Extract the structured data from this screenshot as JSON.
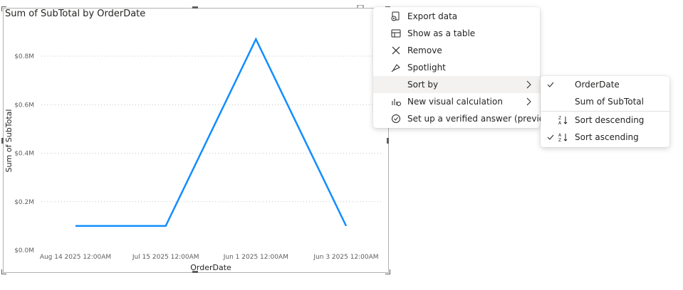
{
  "chart_data": {
    "type": "line",
    "title": "Sum of SubTotal by OrderDate",
    "xlabel": "OrderDate",
    "ylabel": "Sum of SubTotal",
    "categories": [
      "Aug 14 2025 12:00AM",
      "Jul 15 2025 12:00AM",
      "Jun 1 2025 12:00AM",
      "Jun 3 2025 12:00AM"
    ],
    "series": [
      {
        "values": [
          0.1,
          0.1,
          0.87,
          0.1
        ]
      }
    ],
    "ylim": [
      0,
      0.8
    ],
    "yticks": [
      "$0.0M",
      "$0.2M",
      "$0.4M",
      "$0.6M",
      "$0.8M"
    ],
    "ytick_values": [
      0,
      0.2,
      0.4,
      0.6,
      0.8
    ],
    "grid": true,
    "line_color": "#118dff"
  },
  "context_menu": {
    "items": [
      {
        "label": "Export data",
        "icon": "export-icon"
      },
      {
        "label": "Show as a table",
        "icon": "table-icon"
      },
      {
        "label": "Remove",
        "icon": "close-icon"
      },
      {
        "label": "Spotlight",
        "icon": "spotlight-icon"
      },
      {
        "label": "Sort by",
        "icon": ""
      },
      {
        "label": "New visual calculation",
        "icon": "calculation-icon"
      },
      {
        "label": "Set up a verified answer (preview)",
        "icon": "verified-icon"
      }
    ]
  },
  "sort_menu": {
    "fields": [
      {
        "label": "OrderDate",
        "checked": true
      },
      {
        "label": "Sum of SubTotal",
        "checked": false
      }
    ],
    "directions": [
      {
        "label": "Sort descending",
        "checked": false
      },
      {
        "label": "Sort ascending",
        "checked": true
      }
    ]
  }
}
